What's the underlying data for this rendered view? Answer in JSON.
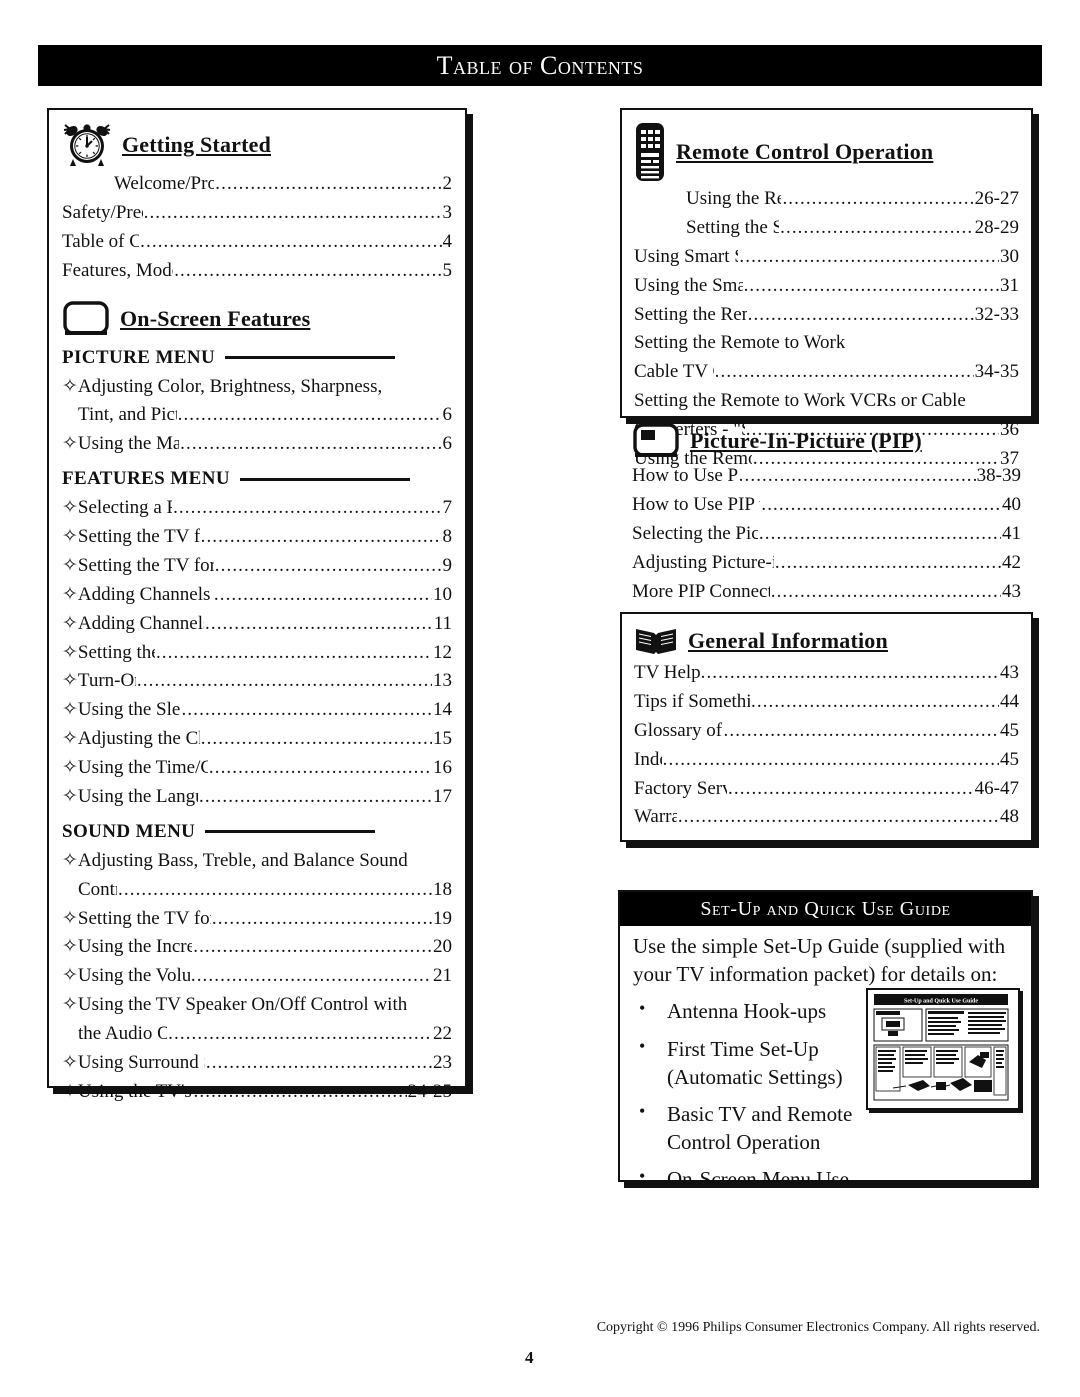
{
  "page": {
    "banner_title": "Table of Contents",
    "page_number": "4",
    "copyright": "Copyright © 1996 Philips Consumer Electronics Company. All rights reserved."
  },
  "left_column": {
    "getting_started": {
      "icon": "alarm-clock-icon",
      "title": "Getting Started",
      "entries": [
        {
          "label": "Welcome/Product Registration",
          "page": "2",
          "indent": true
        },
        {
          "label": "Safety/Precautions",
          "page": "3"
        },
        {
          "label": "Table of Contents",
          "page": "4"
        },
        {
          "label": "Features, Model Information",
          "page": "5"
        }
      ]
    },
    "on_screen_features": {
      "icon": "tv-screen-icon",
      "title": "On-Screen Features",
      "submenus": [
        {
          "name": "PICTURE MENU",
          "entries": [
            {
              "label": "✧Adjusting Color, Brightness, Sharpness,",
              "page": "",
              "nodots": true
            },
            {
              "label": "Tint, and Picture Controls",
              "page": "6",
              "cont": true
            },
            {
              "label": "✧Using the Magnavue Feature",
              "page": "6"
            }
          ]
        },
        {
          "name": "FEATURES MENU",
          "entries": [
            {
              "label": "✧Selecting a Picture Source",
              "page": "7"
            },
            {
              "label": "✧Setting the TV for Closed Captioning",
              "page": "8"
            },
            {
              "label": "✧Setting the TV for Cable or Antenna Signals",
              "page": "9"
            },
            {
              "label": "✧Adding Channels in Memory (Automatically)",
              "page": "10"
            },
            {
              "label": "✧Adding Channels in Memory (Manually)",
              "page": "11"
            },
            {
              "label": "✧Setting the TV Clock",
              "page": "12"
            },
            {
              "label": "✧Turn-On Timer",
              "page": "13"
            },
            {
              "label": "✧Using the Sleep Timer Control",
              "page": "14"
            },
            {
              "label": "✧Adjusting the Channel Display Control",
              "page": "15"
            },
            {
              "label": "✧Using the Time/Channel Reminder Control",
              "page": "16"
            },
            {
              "label": "✧Using the Language Selection Control",
              "page": "17"
            }
          ]
        },
        {
          "name": "SOUND MENU",
          "entries": [
            {
              "label": "✧Adjusting Bass, Treble, and Balance Sound",
              "page": "",
              "nodots": true
            },
            {
              "label": "Controls",
              "page": "18",
              "cont": true
            },
            {
              "label": "✧Setting the TV for Stereo and SAP Programs",
              "page": "19"
            },
            {
              "label": "✧Using the Incredible Stereo Control",
              "page": "20"
            },
            {
              "label": "✧Using the Volume Display Control",
              "page": "21"
            },
            {
              "label": "✧Using the TV Speaker On/Off Control with",
              "page": "",
              "nodots": true
            },
            {
              "label": "the Audio Output Jacks",
              "page": "22",
              "cont": true
            },
            {
              "label": "✧Using Surround Sound External Speakers",
              "page": "23"
            },
            {
              "label": "✧Using the TV's Audio/Video Input Jacks",
              "page": "24-25"
            }
          ]
        }
      ]
    }
  },
  "right_column": {
    "remote_control": {
      "icon": "remote-control-icon",
      "title": "Remote Control Operation",
      "entries": [
        {
          "label": "Using the Remote Locator Feature",
          "page": "26-27",
          "indent": true
        },
        {
          "label": "Setting the Smart Picture Control",
          "page": "28-29",
          "indent": true
        },
        {
          "label": "Using Smart Sound Control",
          "page": "30"
        },
        {
          "label": "Using the Smart Surf Control",
          "page": "31"
        },
        {
          "label": "Setting the Remote to Work VCRs",
          "page": "32-33"
        },
        {
          "label": "Setting the Remote to Work",
          "page": "",
          "nodots": true
        },
        {
          "label": "Cable TV Converters",
          "page": "34-35"
        },
        {
          "label": "Setting the Remote to Work VCRs or Cable",
          "page": "",
          "nodots": true
        },
        {
          "label": "Converters - \"Search Method\"",
          "page": "36"
        },
        {
          "label": "Using the Remote's VCR buttons",
          "page": "37"
        }
      ]
    },
    "pip": {
      "icon": "pip-tv-icon",
      "title": "Picture-In-Picture (PIP)",
      "entries": [
        {
          "label": "How to Use PIP (Connections)",
          "page": "38-39"
        },
        {
          "label": "How to Use PIP with the TV Remote",
          "page": "40"
        },
        {
          "label": "Selecting the Picture Source for PIP",
          "page": "41"
        },
        {
          "label": "Adjusting Picture-in-Picture Color and Tint",
          "page": "42"
        },
        {
          "label": "More PIP Connections (Cable Converter)",
          "page": "43"
        }
      ]
    },
    "general_information": {
      "icon": "open-book-icon",
      "title": "General Information",
      "entries": [
        {
          "label": "TV Help Menu",
          "page": "43"
        },
        {
          "label": "Tips if Something Isn’t Working",
          "page": "44"
        },
        {
          "label": "Glossary of TV Terms",
          "page": "45"
        },
        {
          "label": "Index",
          "page": "45"
        },
        {
          "label": "Factory Service Locations",
          "page": "46-47"
        },
        {
          "label": "Warranty",
          "page": "48"
        }
      ]
    },
    "setup_guide": {
      "banner_title": "Set-Up and Quick Use Guide",
      "intro": "Use the simple Set-Up Guide (supplied with your TV information packet) for details on:",
      "bullets": [
        "Antenna Hook-ups",
        "First Time Set-Up (Automatic Settings)",
        "Basic TV and Remote Control Operation",
        "On-Screen Menu Use"
      ],
      "thumbnail_caption": "Set-Up and Quick Use Guide",
      "thumbnail_icon": "setup-guide-thumbnail"
    }
  }
}
